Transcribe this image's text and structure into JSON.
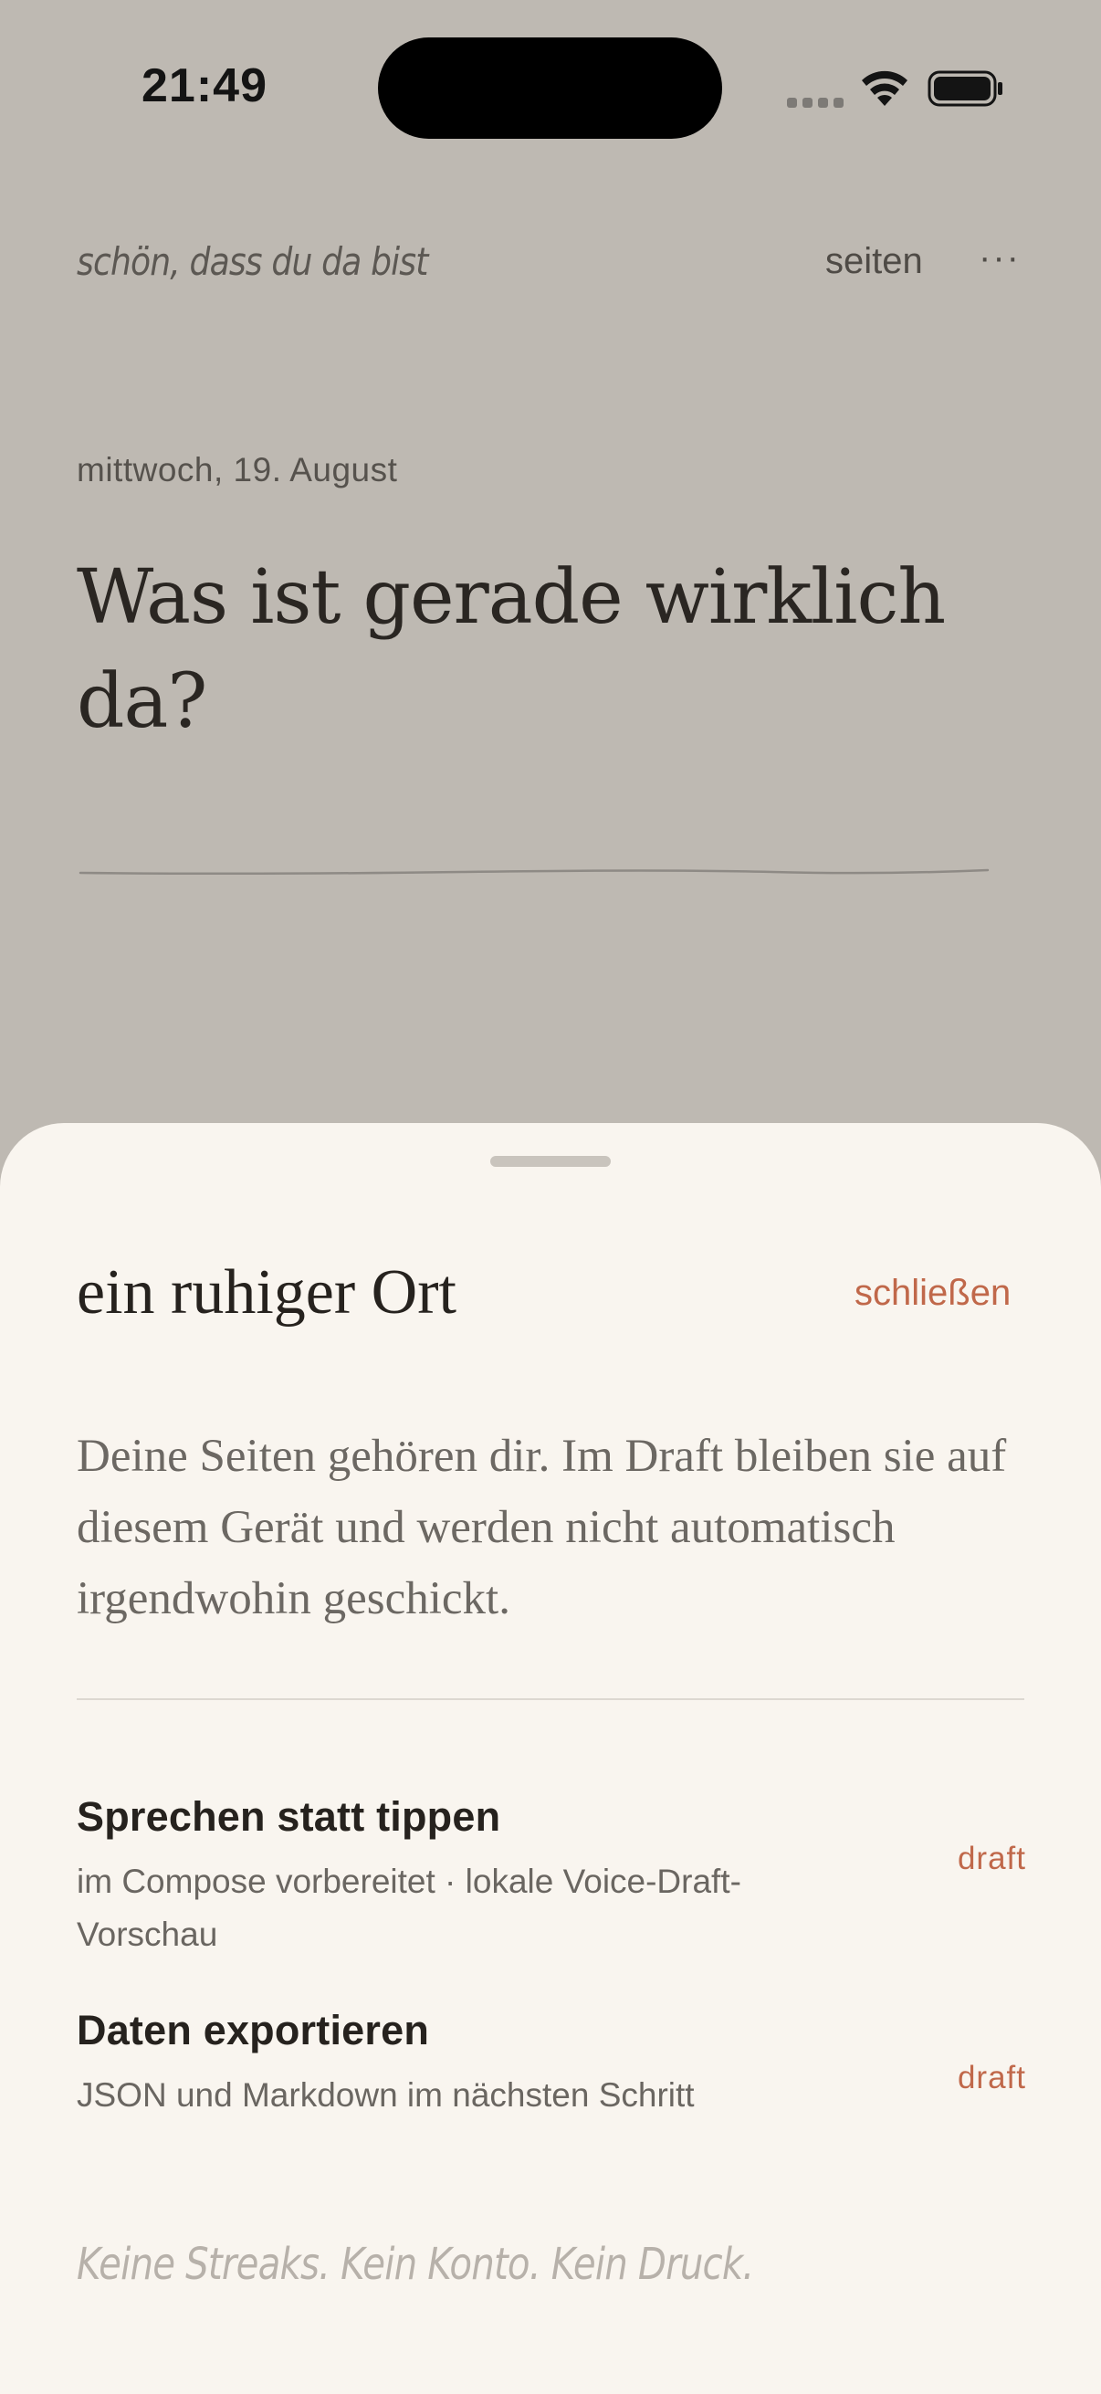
{
  "status_bar": {
    "time": "21:49"
  },
  "header": {
    "greeting": "schön, dass du da bist",
    "pages_link": "seiten",
    "more": "···"
  },
  "entry": {
    "date": "mittwoch, 19. August",
    "prompt": "Was ist gerade wirklich da?"
  },
  "sheet": {
    "title": "ein ruhiger Ort",
    "close_label": "schließen",
    "body": "Deine Seiten gehören dir. Im Draft bleiben sie auf diesem Gerät und werden nicht automatisch irgendwohin geschickt.",
    "features": [
      {
        "title": "Sprechen statt tippen",
        "description": "im Compose vorbereitet · lokale Voice-Draft-Vorschau",
        "badge": "draft"
      },
      {
        "title": "Daten exportieren",
        "description": "JSON und Markdown im nächsten Schritt",
        "badge": "draft"
      }
    ],
    "footer": "Keine Streaks. Kein Konto. Kein Druck."
  },
  "colors": {
    "accent": "#c0684a",
    "sheet_background": "#f9f5ef",
    "dimmed_background": "#beb9b2"
  }
}
